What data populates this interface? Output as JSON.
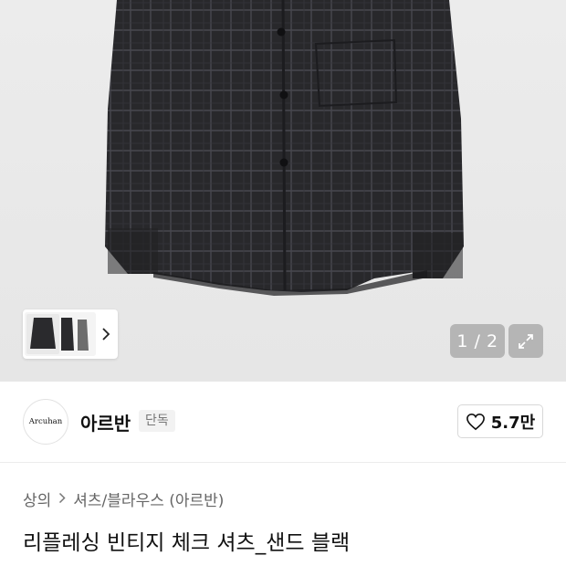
{
  "gallery": {
    "current_page": "1",
    "total_pages": "2",
    "counter_text": "1 / 2",
    "icons": {
      "thumb_next": "chevron-right-icon",
      "expand": "expand-icon"
    }
  },
  "brand": {
    "logo_text": "Arcuhan",
    "name": "아르반",
    "badge": "단독",
    "like_count": "5.7만",
    "like_icon": "heart-icon"
  },
  "breadcrumb": {
    "items": [
      "상의",
      "셔츠/블라우스 (아르반)"
    ],
    "separator_icon": "chevron-right-icon"
  },
  "product": {
    "title": "리플레싱 빈티지 체크 셔츠_샌드 블랙"
  },
  "colors": {
    "shirt": "#2a2a2c",
    "check_line": "#4a4a52",
    "background": "#e8e8e8",
    "overlay": "#8c8c8c"
  }
}
